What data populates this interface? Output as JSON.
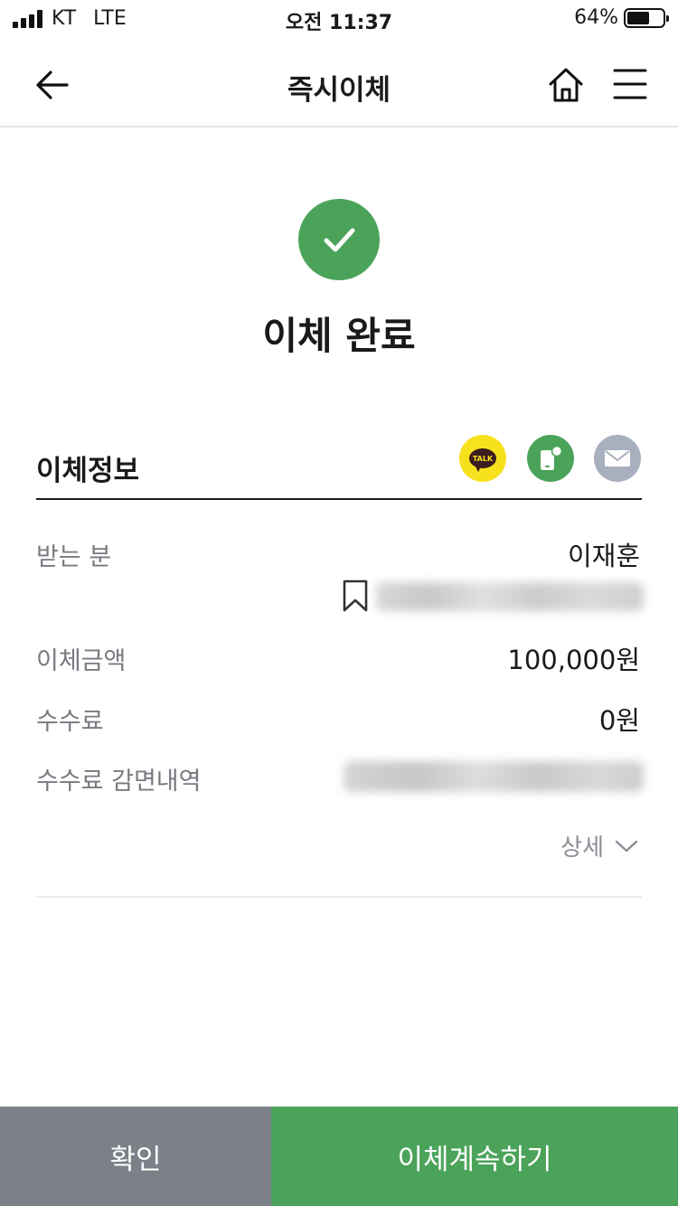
{
  "status_bar": {
    "carrier": "KT",
    "network": "LTE",
    "time": "오전 11:37",
    "battery": "64%",
    "battery_level": 0.64
  },
  "nav": {
    "title": "즉시이체",
    "back_icon": "arrow-left-icon",
    "home_icon": "home-icon",
    "menu_icon": "hamburger-menu-icon"
  },
  "result": {
    "title": "이체 완료",
    "icon": "check-icon",
    "color": "#4ba35a"
  },
  "transfer_info": {
    "title": "이체정보",
    "share_icons": [
      "kakaotalk-icon",
      "sms-icon",
      "mail-icon"
    ],
    "kakao_label": "TALK",
    "rows": [
      {
        "label": "받는 분",
        "value": "이재훈"
      },
      {
        "label": "이체금액",
        "value": "100,000원"
      },
      {
        "label": "수수료",
        "value": "0원"
      },
      {
        "label": "수수료 감면내역",
        "value": ""
      }
    ],
    "detail_label": "상세"
  },
  "buttons": {
    "confirm": "확인",
    "continue": "이체계속하기"
  },
  "colors": {
    "accent_green": "#4ba35a",
    "confirm_gray": "#7c8089",
    "kakao_yellow": "#f7e11c",
    "mail_gray": "#a8b0bf"
  }
}
